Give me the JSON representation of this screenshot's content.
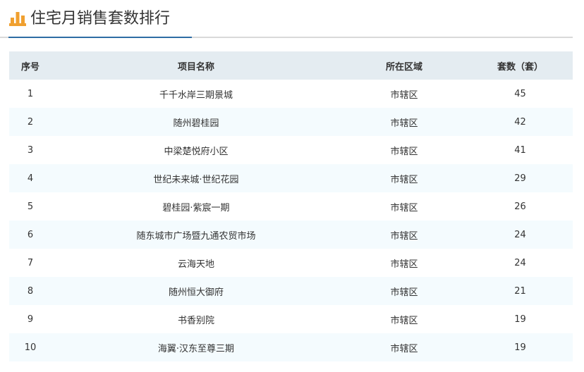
{
  "header": {
    "title": "住宅月销售套数排行",
    "icon": "bar-chart-icon",
    "icon_color": "#f0a030",
    "accent_color": "#2e6da4"
  },
  "table": {
    "columns": [
      "序号",
      "项目名称",
      "所在区域",
      "套数（套）"
    ],
    "rows": [
      {
        "no": "1",
        "name": "千千水岸三期景城",
        "area": "市辖区",
        "count": "45"
      },
      {
        "no": "2",
        "name": "随州碧桂园",
        "area": "市辖区",
        "count": "42"
      },
      {
        "no": "3",
        "name": "中梁楚悦府小区",
        "area": "市辖区",
        "count": "41"
      },
      {
        "no": "4",
        "name": "世纪未来城·世纪花园",
        "area": "市辖区",
        "count": "29"
      },
      {
        "no": "5",
        "name": "碧桂园·紫宸一期",
        "area": "市辖区",
        "count": "26"
      },
      {
        "no": "6",
        "name": "随东城市广场暨九通农贸市场",
        "area": "市辖区",
        "count": "24"
      },
      {
        "no": "7",
        "name": "云海天地",
        "area": "市辖区",
        "count": "24"
      },
      {
        "no": "8",
        "name": "随州恒大御府",
        "area": "市辖区",
        "count": "21"
      },
      {
        "no": "9",
        "name": "书香别院",
        "area": "市辖区",
        "count": "19"
      },
      {
        "no": "10",
        "name": "海翼·汉东至尊三期",
        "area": "市辖区",
        "count": "19"
      }
    ]
  }
}
